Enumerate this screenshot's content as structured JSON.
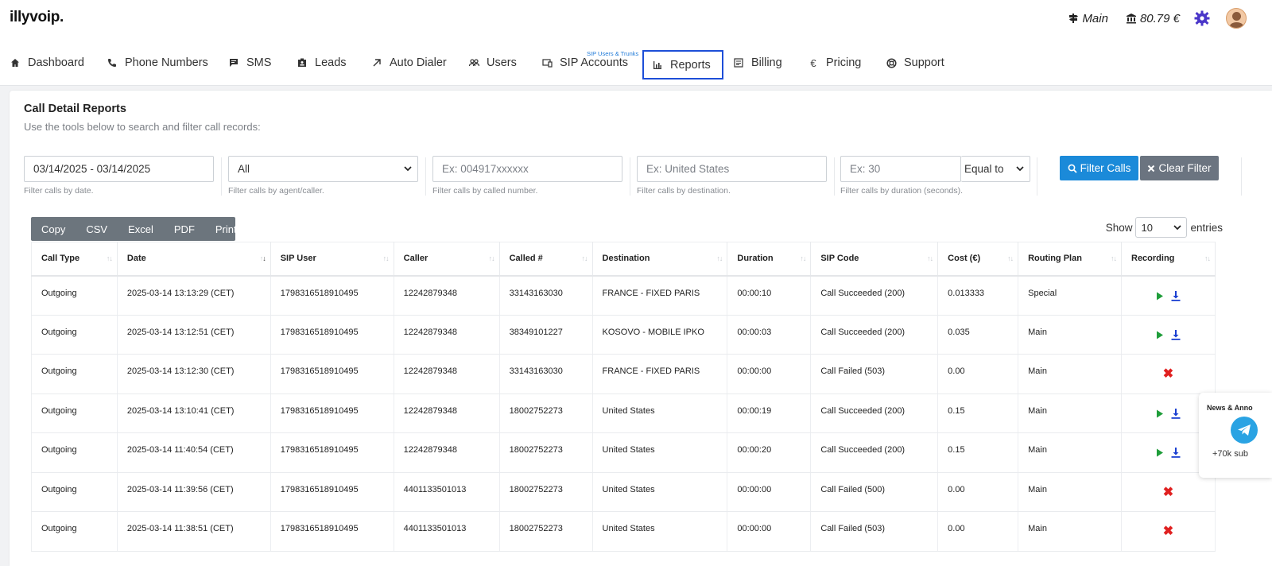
{
  "brand": {
    "logo": "illyvoip."
  },
  "account": {
    "plan": "Main",
    "balance": "80.79 €"
  },
  "nav": {
    "superscript": "SIP Users & Trunks",
    "items": [
      {
        "label": "Dashboard",
        "icon": "home-icon"
      },
      {
        "label": "Phone Numbers",
        "icon": "phone-icon"
      },
      {
        "label": "SMS",
        "icon": "sms-icon"
      },
      {
        "label": "Leads",
        "icon": "leads-icon"
      },
      {
        "label": "Auto Dialer",
        "icon": "arrow-icon"
      },
      {
        "label": "Users",
        "icon": "users-icon"
      },
      {
        "label": "SIP Accounts",
        "icon": "sip-icon"
      },
      {
        "label": "Reports",
        "icon": "chart-icon",
        "active": true
      },
      {
        "label": "Billing",
        "icon": "billing-icon"
      },
      {
        "label": "Pricing",
        "icon": "euro-icon"
      },
      {
        "label": "Support",
        "icon": "support-icon"
      }
    ]
  },
  "page": {
    "title": "Call Detail Reports",
    "subtitle": "Use the tools below to search and filter call records:"
  },
  "filters": {
    "date": {
      "value": "03/14/2025 - 03/14/2025",
      "hint": "Filter calls by date."
    },
    "agent": {
      "value": "All",
      "hint": "Filter calls by agent/caller."
    },
    "called": {
      "placeholder": "Ex: 004917xxxxxx",
      "hint": "Filter calls by called number."
    },
    "destination": {
      "placeholder": "Ex: United States",
      "hint": "Filter calls by destination."
    },
    "duration": {
      "placeholder": "Ex: 30",
      "operator": "Equal to",
      "hint": "Filter calls by duration (seconds)."
    },
    "filter_label": "Filter Calls",
    "clear_label": "Clear Filter"
  },
  "export": {
    "buttons": [
      "Copy",
      "CSV",
      "Excel",
      "PDF",
      "Print"
    ]
  },
  "length": {
    "show": "Show",
    "value": "10",
    "entries": "entries"
  },
  "table": {
    "columns": [
      "Call Type",
      "Date",
      "SIP User",
      "Caller",
      "Called #",
      "Destination",
      "Duration",
      "SIP Code",
      "Cost (€)",
      "Routing Plan",
      "Recording"
    ],
    "rows": [
      [
        "Outgoing",
        "2025-03-14 13:13:29 (CET)",
        "1798316518910495",
        "12242879348",
        "33143163030",
        "FRANCE - FIXED PARIS",
        "00:00:10",
        "Call Succeeded (200)",
        "0.013333",
        "Special",
        "play"
      ],
      [
        "Outgoing",
        "2025-03-14 13:12:51 (CET)",
        "1798316518910495",
        "12242879348",
        "38349101227",
        "KOSOVO - MOBILE IPKO",
        "00:00:03",
        "Call Succeeded (200)",
        "0.035",
        "Main",
        "play"
      ],
      [
        "Outgoing",
        "2025-03-14 13:12:30 (CET)",
        "1798316518910495",
        "12242879348",
        "33143163030",
        "FRANCE - FIXED PARIS",
        "00:00:00",
        "Call Failed (503)",
        "0.00",
        "Main",
        "fail"
      ],
      [
        "Outgoing",
        "2025-03-14 13:10:41 (CET)",
        "1798316518910495",
        "12242879348",
        "18002752273",
        "United States",
        "00:00:19",
        "Call Succeeded (200)",
        "0.15",
        "Main",
        "play"
      ],
      [
        "Outgoing",
        "2025-03-14 11:40:54 (CET)",
        "1798316518910495",
        "12242879348",
        "18002752273",
        "United States",
        "00:00:20",
        "Call Succeeded (200)",
        "0.15",
        "Main",
        "play"
      ],
      [
        "Outgoing",
        "2025-03-14 11:39:56 (CET)",
        "1798316518910495",
        "4401133501013",
        "18002752273",
        "United States",
        "00:00:00",
        "Call Failed (500)",
        "0.00",
        "Main",
        "fail"
      ],
      [
        "Outgoing",
        "2025-03-14 11:38:51 (CET)",
        "1798316518910495",
        "4401133501013",
        "18002752273",
        "United States",
        "00:00:00",
        "Call Failed (503)",
        "0.00",
        "Main",
        "fail"
      ]
    ]
  },
  "news": {
    "title": "News & Anno",
    "subs": "+70k sub"
  }
}
